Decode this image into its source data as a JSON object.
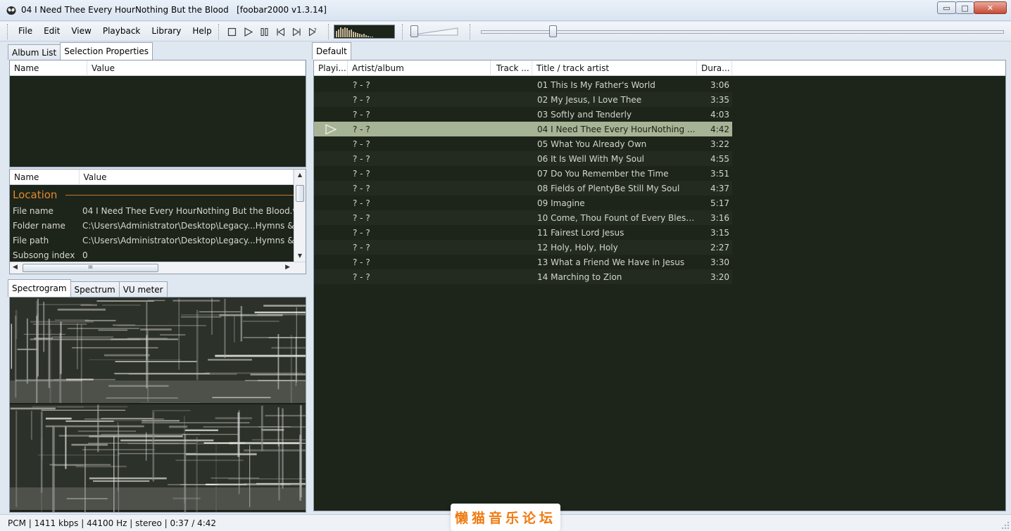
{
  "window": {
    "title": "04 I Need Thee Every HourNothing But the Blood   [foobar2000 v1.3.14]",
    "app_icon": "foobar-alien-icon",
    "buttons": {
      "minimize": "▭",
      "maximize": "□",
      "close": "✕"
    }
  },
  "menu": [
    "File",
    "Edit",
    "View",
    "Playback",
    "Library",
    "Help"
  ],
  "transport": [
    "stop-icon",
    "play-icon",
    "pause-icon",
    "previous-icon",
    "next-icon",
    "random-icon"
  ],
  "mini_visualizer_levels": [
    0.55,
    0.7,
    0.85,
    0.75,
    0.9,
    0.8,
    0.65,
    0.7,
    0.5,
    0.45,
    0.35,
    0.3,
    0.25,
    0.3,
    0.2,
    0.1,
    0.08,
    0.05
  ],
  "volume_level": 0.05,
  "seek_position": 0.131,
  "left_tabs": {
    "album_list": "Album List",
    "selection_properties": "Selection Properties"
  },
  "upper_panel": {
    "col_name": "Name",
    "col_value": "Value"
  },
  "properties": {
    "col_name": "Name",
    "col_value": "Value",
    "group": "Location",
    "rows": [
      {
        "name": "File name",
        "value": "04 I Need Thee Every HourNothing But the Blood.w"
      },
      {
        "name": "Folder name",
        "value": "C:\\Users\\Administrator\\Desktop\\Legacy...Hymns &  "
      },
      {
        "name": "File path",
        "value": "C:\\Users\\Administrator\\Desktop\\Legacy...Hymns &  "
      },
      {
        "name": "Subsong index",
        "value": "0"
      }
    ],
    "hscroll_grip": "III"
  },
  "vis_tabs": {
    "spectrogram": "Spectrogram",
    "spectrum": "Spectrum",
    "vu_meter": "VU meter"
  },
  "playlist": {
    "tab": "Default",
    "columns": {
      "playing": "Playi...",
      "artist": "Artist/album",
      "track": "Track ...",
      "title": "Title / track artist",
      "duration": "Dura..."
    },
    "rows": [
      {
        "artist": "? - ?",
        "title": "01 This Is My Father's World",
        "duration": "3:06"
      },
      {
        "artist": "? - ?",
        "title": "02 My Jesus, I Love Thee",
        "duration": "3:35"
      },
      {
        "artist": "? - ?",
        "title": "03 Softly and Tenderly",
        "duration": "4:03"
      },
      {
        "artist": "? - ?",
        "title": "04 I Need Thee Every HourNothing ...",
        "duration": "4:42",
        "playing": true
      },
      {
        "artist": "? - ?",
        "title": "05 What You Already Own",
        "duration": "3:22"
      },
      {
        "artist": "? - ?",
        "title": "06 It Is Well With My Soul",
        "duration": "4:55"
      },
      {
        "artist": "? - ?",
        "title": "07 Do You Remember the Time",
        "duration": "3:51"
      },
      {
        "artist": "? - ?",
        "title": "08 Fields of PlentyBe Still My Soul",
        "duration": "4:37"
      },
      {
        "artist": "? - ?",
        "title": "09 Imagine",
        "duration": "5:17"
      },
      {
        "artist": "? - ?",
        "title": "10 Come, Thou Fount of Every Blessi...",
        "duration": "3:16"
      },
      {
        "artist": "? - ?",
        "title": "11 Fairest Lord Jesus",
        "duration": "3:15"
      },
      {
        "artist": "? - ?",
        "title": "12 Holy, Holy, Holy",
        "duration": "2:27"
      },
      {
        "artist": "? - ?",
        "title": "13 What a Friend We Have in Jesus",
        "duration": "3:30"
      },
      {
        "artist": "? - ?",
        "title": "14 Marching to Zion",
        "duration": "3:20"
      }
    ]
  },
  "status": {
    "text": "PCM | 1411 kbps | 44100 Hz | stereo | 0:37 / 4:42"
  },
  "watermark": "懒猫音乐论坛",
  "colors": {
    "panel_bg": "#1d2419",
    "selected_row": "#a7b395",
    "group_header": "#e1892f"
  }
}
